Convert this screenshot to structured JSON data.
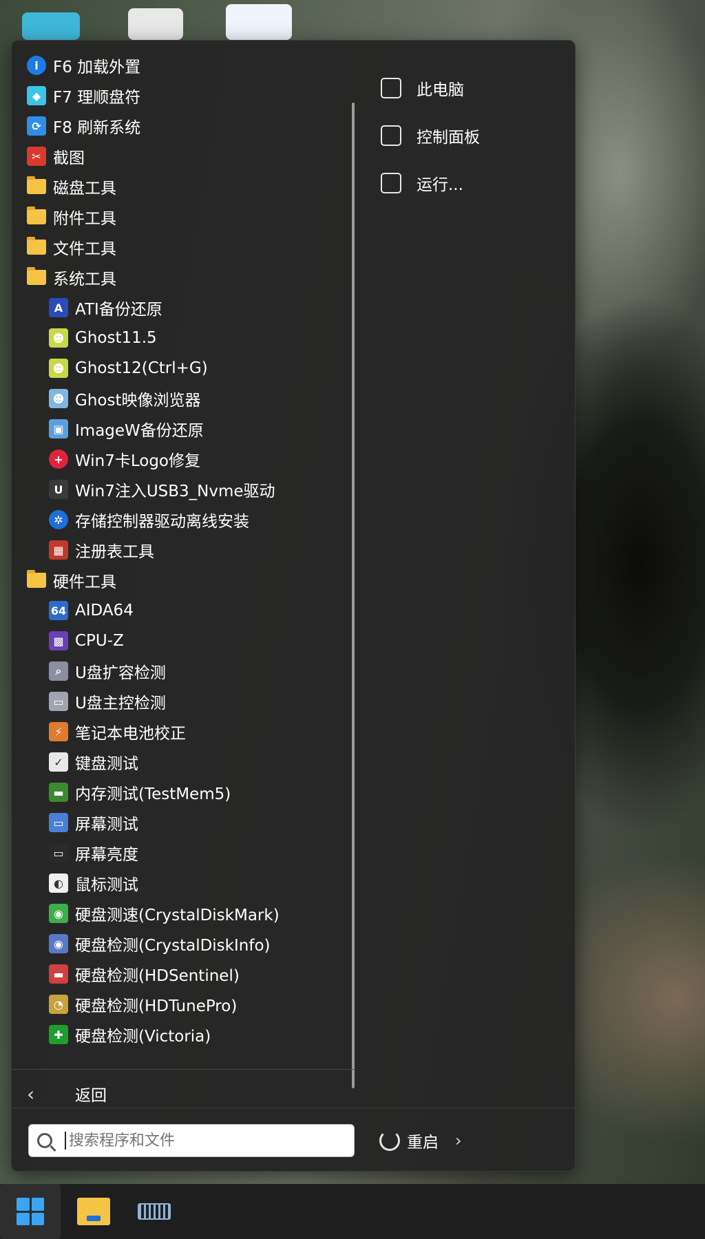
{
  "menu": {
    "items": [
      {
        "label": "F6 加载外置",
        "level": 1,
        "icon": "info-icon",
        "color": "#1e7ae6",
        "glyph": "i"
      },
      {
        "label": "F7 理顺盘符",
        "level": 1,
        "icon": "cube-icon",
        "color": "#3cc3e8",
        "glyph": "◆"
      },
      {
        "label": "F8 刷新系统",
        "level": 1,
        "icon": "refresh-icon",
        "color": "#2e8de6",
        "glyph": "⟳"
      },
      {
        "label": "截图",
        "level": 1,
        "icon": "screenshot-icon",
        "color": "#d93a2e",
        "glyph": "✂"
      },
      {
        "label": "磁盘工具",
        "level": 1,
        "icon": "folder-icon",
        "folder": true
      },
      {
        "label": "附件工具",
        "level": 1,
        "icon": "folder-icon",
        "folder": true
      },
      {
        "label": "文件工具",
        "level": 1,
        "icon": "folder-icon",
        "folder": true
      },
      {
        "label": "系统工具",
        "level": 1,
        "icon": "folder-icon",
        "folder": true
      },
      {
        "label": "ATI备份还原",
        "level": 2,
        "icon": "ati-icon",
        "color": "#2a4bb8",
        "glyph": "A"
      },
      {
        "label": "Ghost11.5",
        "level": 2,
        "icon": "ghost-icon",
        "color": "#c9d84a",
        "glyph": "☻"
      },
      {
        "label": "Ghost12(Ctrl+G)",
        "level": 2,
        "icon": "ghost-icon",
        "color": "#c9d84a",
        "glyph": "☻"
      },
      {
        "label": "Ghost映像浏览器",
        "level": 2,
        "icon": "ghost-explorer-icon",
        "color": "#7fb8e0",
        "glyph": "☻"
      },
      {
        "label": "ImageW备份还原",
        "level": 2,
        "icon": "imagew-icon",
        "color": "#5aa0e0",
        "glyph": "▣"
      },
      {
        "label": "Win7卡Logo修复",
        "level": 2,
        "icon": "repair-icon",
        "color": "#e0243c",
        "glyph": "+"
      },
      {
        "label": "Win7注入USB3_Nvme驱动",
        "level": 2,
        "icon": "usb-icon",
        "color": "#3a3a3a",
        "glyph": "U"
      },
      {
        "label": "存储控制器驱动离线安装",
        "level": 2,
        "icon": "gear-icon",
        "color": "#1e6fd9",
        "glyph": "✲"
      },
      {
        "label": "注册表工具",
        "level": 2,
        "icon": "registry-icon",
        "color": "#c0392b",
        "glyph": "▦"
      },
      {
        "label": "硬件工具",
        "level": 1,
        "icon": "folder-icon",
        "folder": true
      },
      {
        "label": "AIDA64",
        "level": 2,
        "icon": "aida64-icon",
        "color": "#2f6bcc",
        "glyph": "64"
      },
      {
        "label": "CPU-Z",
        "level": 2,
        "icon": "cpu-icon",
        "color": "#6b3fb5",
        "glyph": "▩"
      },
      {
        "label": "U盘扩容检测",
        "level": 2,
        "icon": "usb-drive-icon",
        "color": "#8a8fa0",
        "glyph": "⌕"
      },
      {
        "label": "U盘主控检测",
        "level": 2,
        "icon": "usb-drive-icon",
        "color": "#a0a4b0",
        "glyph": "▭"
      },
      {
        "label": "笔记本电池校正",
        "level": 2,
        "icon": "battery-icon",
        "color": "#e07a2e",
        "glyph": "⚡"
      },
      {
        "label": "键盘测试",
        "level": 2,
        "icon": "keyboard-test-icon",
        "color": "#e8e8e8",
        "glyph": "✓"
      },
      {
        "label": "内存测试(TestMem5)",
        "level": 2,
        "icon": "memory-icon",
        "color": "#3a8a2e",
        "glyph": "▬"
      },
      {
        "label": "屏幕测试",
        "level": 2,
        "icon": "screen-test-icon",
        "color": "#4a7fd8",
        "glyph": "▭"
      },
      {
        "label": "屏幕亮度",
        "level": 2,
        "icon": "monitor-icon",
        "color": "#2a2a2a",
        "glyph": "▭"
      },
      {
        "label": "鼠标测试",
        "level": 2,
        "icon": "mouse-icon",
        "color": "#f0f0f0",
        "glyph": "◐"
      },
      {
        "label": "硬盘测速(CrystalDiskMark)",
        "level": 2,
        "icon": "diskmark-icon",
        "color": "#3cae4a",
        "glyph": "◉"
      },
      {
        "label": "硬盘检测(CrystalDiskInfo)",
        "level": 2,
        "icon": "diskinfo-icon",
        "color": "#5a78c8",
        "glyph": "◉"
      },
      {
        "label": "硬盘检测(HDSentinel)",
        "level": 2,
        "icon": "hdsentinel-icon",
        "color": "#d04040",
        "glyph": "▬"
      },
      {
        "label": "硬盘检测(HDTunePro)",
        "level": 2,
        "icon": "hdtune-icon",
        "color": "#c8a23a",
        "glyph": "◔"
      },
      {
        "label": "硬盘检测(Victoria)",
        "level": 2,
        "icon": "victoria-icon",
        "color": "#1e9e2e",
        "glyph": "✚"
      }
    ],
    "right": [
      {
        "label": "此电脑",
        "icon": "computer-icon"
      },
      {
        "label": "控制面板",
        "icon": "control-panel-icon"
      },
      {
        "label": "运行...",
        "icon": "run-icon"
      }
    ],
    "back_label": "返回",
    "search_placeholder": "搜索程序和文件",
    "restart_label": "重启"
  },
  "taskbar": {
    "items": [
      "start-icon",
      "file-explorer-icon",
      "keyboard-icon"
    ]
  }
}
